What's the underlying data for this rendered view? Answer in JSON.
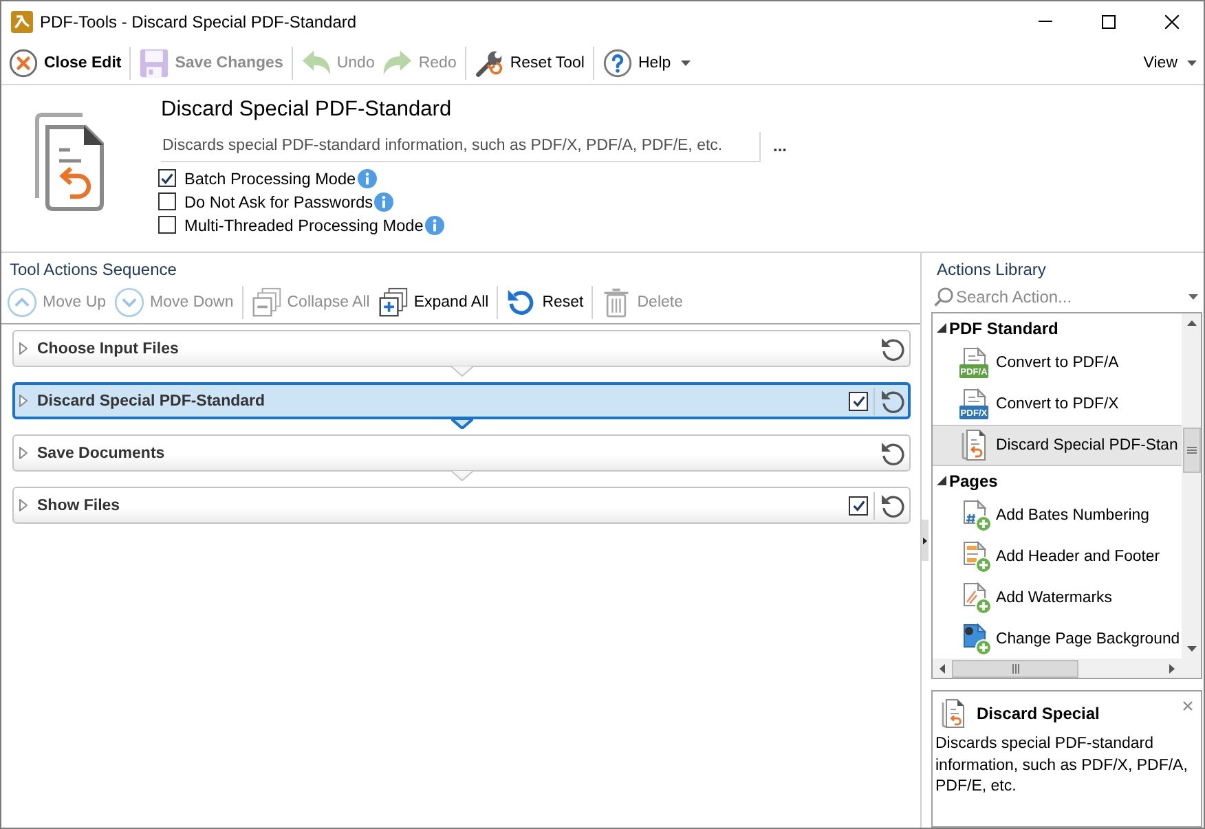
{
  "window": {
    "title": "PDF-Tools - Discard Special PDF-Standard"
  },
  "toolbar": {
    "groups": [
      [
        {
          "kind": "close",
          "label": "Close Edit",
          "disabled": false
        }
      ],
      [
        {
          "kind": "save",
          "label": "Save Changes",
          "disabled": true
        }
      ],
      [
        {
          "kind": "undo",
          "label": "Undo",
          "disabled": true
        },
        {
          "kind": "redo",
          "label": "Redo",
          "disabled": true
        }
      ],
      [
        {
          "kind": "reset",
          "label": "Reset Tool",
          "disabled": false
        }
      ],
      [
        {
          "kind": "help",
          "label": "Help",
          "disabled": false,
          "menu": true
        }
      ]
    ],
    "view": {
      "label": "View",
      "menu": true
    }
  },
  "tool": {
    "title": "Discard Special PDF-Standard",
    "description": "Discards special PDF-standard information, such as PDF/X, PDF/A, PDF/E, etc.",
    "more": "...",
    "options": [
      {
        "label": "Batch Processing Mode",
        "checked": true
      },
      {
        "label": "Do Not Ask for Passwords",
        "checked": false
      },
      {
        "label": "Multi-Threaded Processing Mode",
        "checked": false
      }
    ]
  },
  "sequence": {
    "title": "Tool Actions Sequence",
    "toolbar": [
      [
        {
          "kind": "move-up",
          "label": "Move Up",
          "disabled": true
        },
        {
          "kind": "move-down",
          "label": "Move Down",
          "disabled": true
        }
      ],
      [
        {
          "kind": "collapse",
          "label": "Collapse All",
          "disabled": true
        },
        {
          "kind": "expand",
          "label": "Expand All",
          "disabled": false
        }
      ],
      [
        {
          "kind": "reset",
          "label": "Reset",
          "disabled": false
        }
      ],
      [
        {
          "kind": "delete",
          "label": "Delete",
          "disabled": true
        }
      ]
    ],
    "actions": [
      {
        "label": "Choose Input Files",
        "selected": false,
        "expanded": false
      },
      {
        "label": "Discard Special PDF-Standard",
        "selected": true,
        "expanded": false,
        "checked": true
      },
      {
        "label": "Save Documents",
        "selected": false,
        "expanded": false
      },
      {
        "label": "Show Files",
        "selected": false,
        "expanded": false,
        "checked": true
      }
    ]
  },
  "library": {
    "title": "Actions Library",
    "search": {
      "placeholder": "Search Action..."
    },
    "groups": [
      {
        "label": "PDF Standard",
        "expanded": true,
        "children": [
          {
            "kind": "pdfa",
            "label": "Convert to PDF/A",
            "badge": "PDF/A",
            "selected": false
          },
          {
            "kind": "pdfx",
            "label": "Convert to PDF/X",
            "badge": "PDF/X",
            "selected": false
          },
          {
            "kind": "discard",
            "label": "Discard Special PDF-Stan",
            "selected": true
          }
        ]
      },
      {
        "label": "Pages",
        "expanded": true,
        "children": [
          {
            "kind": "bates",
            "label": "Add Bates Numbering",
            "selected": false
          },
          {
            "kind": "header-footer",
            "label": "Add Header and Footer",
            "selected": false
          },
          {
            "kind": "watermark",
            "label": "Add Watermarks",
            "selected": false
          },
          {
            "kind": "background",
            "label": "Change Page Background",
            "selected": false
          }
        ]
      }
    ]
  },
  "info": {
    "title": "Discard Special",
    "description": "Discards special PDF-standard information, such as PDF/X, PDF/A, PDF/E, etc."
  }
}
